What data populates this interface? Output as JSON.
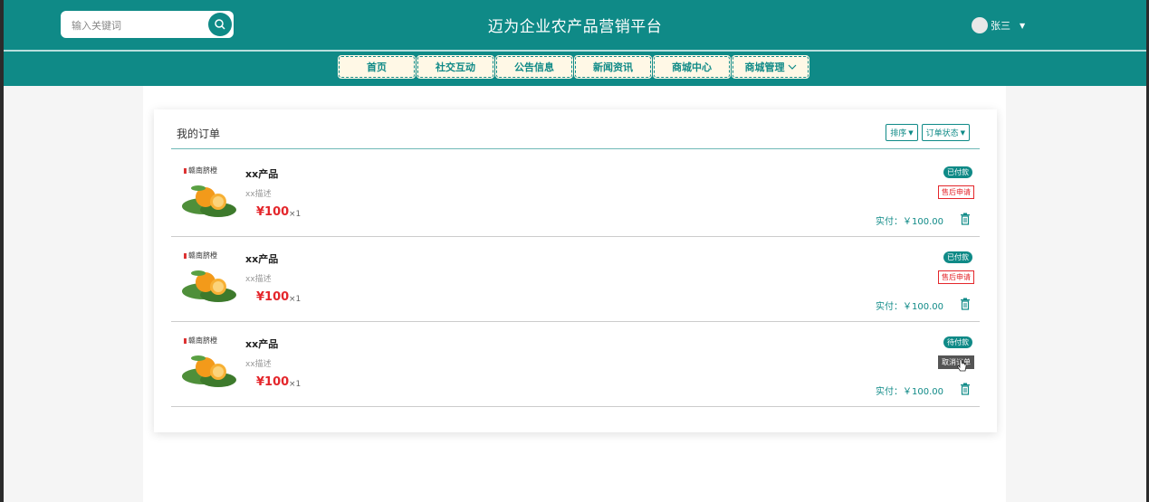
{
  "header": {
    "search_placeholder": "输入关键词",
    "title": "迈为企业农产品营销平台",
    "username": "张三"
  },
  "nav": {
    "items": [
      "首页",
      "社交互动",
      "公告信息",
      "新闻资讯",
      "商城中心",
      "商城管理"
    ]
  },
  "orders_card": {
    "title": "我的订单",
    "sort_label": "排序",
    "status_filter_label": "订单状态"
  },
  "orders": [
    {
      "name": "xx产品",
      "desc": "xx描述",
      "price": "¥100",
      "qty": "×1",
      "status": "已付款",
      "action": "售后申请",
      "paid": "实付：￥100.00"
    },
    {
      "name": "xx产品",
      "desc": "xx描述",
      "price": "¥100",
      "qty": "×1",
      "status": "已付款",
      "action": "售后申请",
      "paid": "实付：￥100.00"
    },
    {
      "name": "xx产品",
      "desc": "xx描述",
      "price": "¥100",
      "qty": "×1",
      "status": "待付款",
      "action": "取消订单",
      "paid": "实付：￥100.00"
    }
  ],
  "colors": {
    "primary": "#0f8a87",
    "price": "#e4262b"
  }
}
